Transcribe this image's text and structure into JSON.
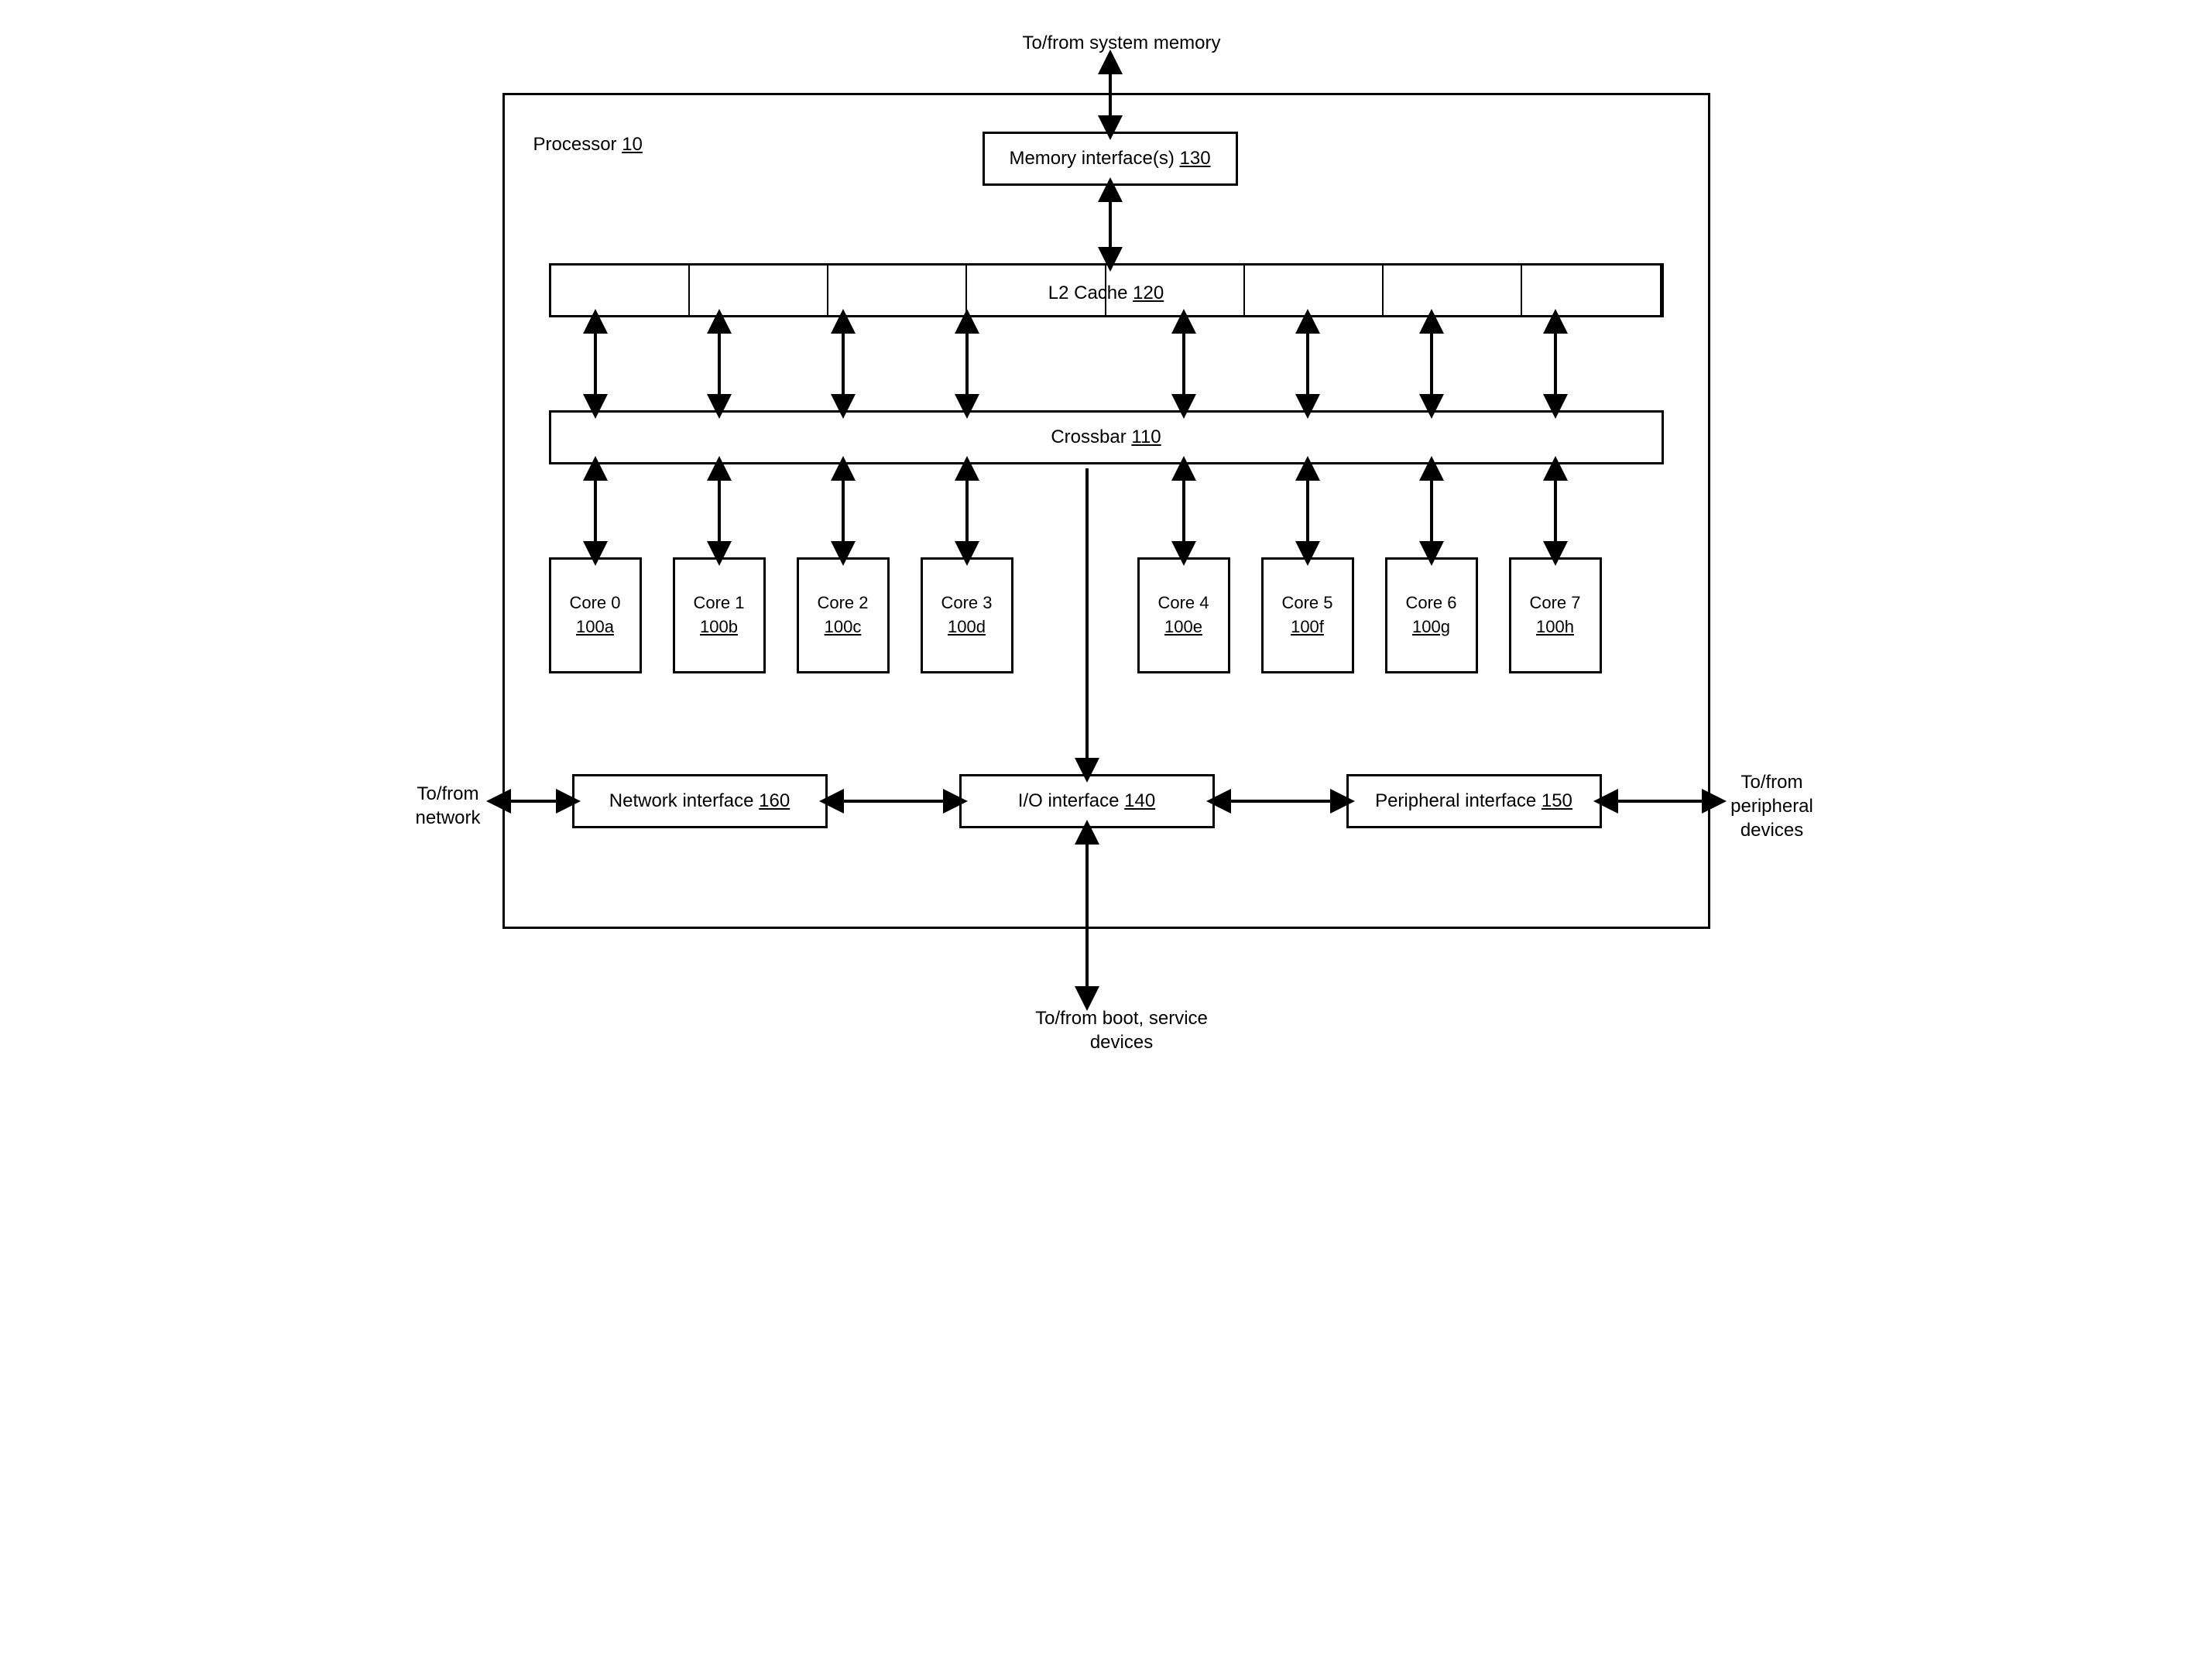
{
  "external": {
    "system_memory": "To/from system memory",
    "network": "To/from\nnetwork",
    "peripheral": "To/from\nperipheral\ndevices",
    "boot": "To/from boot, service\ndevices"
  },
  "processor": {
    "title_prefix": "Processor ",
    "title_num": "10"
  },
  "memory_if": {
    "label": "Memory interface(s) ",
    "num": "130"
  },
  "l2": {
    "label": "L2 Cache ",
    "num": "120"
  },
  "crossbar": {
    "label": "Crossbar ",
    "num": "110"
  },
  "cores": [
    {
      "name": "Core\n0",
      "num": "100a"
    },
    {
      "name": "Core\n1",
      "num": "100b"
    },
    {
      "name": "Core\n2",
      "num": "100c"
    },
    {
      "name": "Core\n3",
      "num": "100d"
    },
    {
      "name": "Core\n4",
      "num": "100e"
    },
    {
      "name": "Core\n5",
      "num": "100f"
    },
    {
      "name": "Core\n6",
      "num": "100g"
    },
    {
      "name": "Core\n7",
      "num": "100h"
    }
  ],
  "net_if": {
    "label": "Network interface ",
    "num": "160"
  },
  "io_if": {
    "label": "I/O interface ",
    "num": "140"
  },
  "periph_if": {
    "label": "Peripheral interface ",
    "num": "150"
  }
}
